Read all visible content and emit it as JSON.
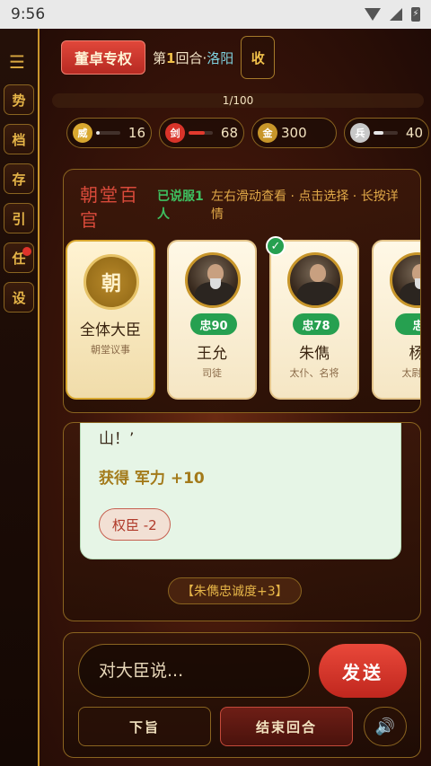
{
  "status_bar": {
    "time": "9:56",
    "battery_glyph": "⚡"
  },
  "sidebar": {
    "menu_glyph": "☰",
    "buttons": [
      {
        "label": "势"
      },
      {
        "label": "档"
      },
      {
        "label": "存"
      },
      {
        "label": "引"
      },
      {
        "label": "任",
        "has_notification": true
      },
      {
        "label": "设"
      }
    ]
  },
  "header": {
    "faction_label": "董卓专权",
    "turn_prefix": "第",
    "turn_number": "1",
    "turn_suffix": "回合·",
    "city": "洛阳",
    "collapse_label": "收"
  },
  "progress": {
    "text": "1/100",
    "value": 1,
    "max": 100
  },
  "stats": [
    {
      "icon_label": "威",
      "value": "16",
      "fraction": 0.16,
      "icon_color": "#d9a830",
      "bar_color": "#e6e6e6"
    },
    {
      "icon_label": "剑",
      "value": "68",
      "fraction": 0.68,
      "icon_color": "#d9342a",
      "bar_color": "#e23a2e"
    },
    {
      "icon_label": "金",
      "value": "300",
      "fraction": 1.0,
      "icon_color": "#c8962a",
      "bar_color": "#e6b548"
    },
    {
      "icon_label": "兵",
      "value": "40",
      "fraction": 0.4,
      "icon_color": "#c8c8c8",
      "bar_color": "#e6e6e6"
    }
  ],
  "court": {
    "title": "朝堂百官",
    "persuaded": "已说服1人",
    "hint": "左右滑动查看 · 点击选择 · 长按详情",
    "cards": [
      {
        "seal": "朝",
        "name": "全体大臣",
        "title": "朝堂议事",
        "selected": true
      },
      {
        "loyalty": "忠90",
        "name": "王允",
        "title": "司徒",
        "checked": false
      },
      {
        "loyalty": "忠78",
        "name": "朱儁",
        "title": "太仆、名将",
        "checked": true
      },
      {
        "loyalty": "忠",
        "name": "杨",
        "title": "太尉、",
        "checked": false
      }
    ]
  },
  "message": {
    "text": "山！’",
    "gain": "获得 军力 +10",
    "tag": "权臣 -2",
    "event": "【朱儁忠诚度+3】"
  },
  "input": {
    "placeholder": "对大臣说...",
    "send_label": "发送",
    "order_label": "下旨",
    "end_turn_label": "结束回合",
    "sound_glyph": "🔊"
  },
  "colors": {
    "accent_gold": "#e6b548",
    "accent_red": "#d9342a",
    "loyalty_green": "#26a050"
  }
}
